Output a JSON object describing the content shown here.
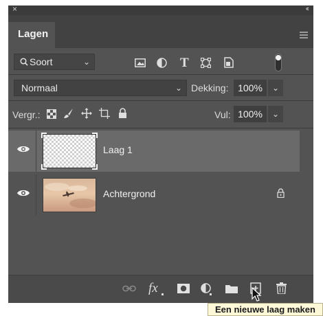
{
  "panel": {
    "tab_title": "Lagen",
    "close_glyph": "×",
    "collapse_glyph": "‹‹"
  },
  "filter": {
    "search_label": "Soort",
    "icons": [
      "image-filter-icon",
      "adjustment-filter-icon",
      "type-filter-icon",
      "shape-filter-icon",
      "smart-object-filter-icon",
      "filter-toggle-icon"
    ]
  },
  "blend": {
    "mode": "Normaal",
    "opacity_label": "Dekking:",
    "opacity_value": "100%"
  },
  "lock": {
    "label": "Vergr.:",
    "fill_label": "Vul:",
    "fill_value": "100%"
  },
  "layers": [
    {
      "name": "Laag 1",
      "visible": true,
      "selected": true,
      "thumbnail": "transparent"
    },
    {
      "name": "Achtergrond",
      "visible": true,
      "selected": false,
      "thumbnail": "sky-with-airplane",
      "locked": true
    }
  ],
  "bottom_icons": [
    "link-layers-icon",
    "fx-icon",
    "layer-mask-icon",
    "adjustment-layer-icon",
    "group-folder-icon",
    "new-layer-icon",
    "trash-icon"
  ],
  "fx_label": "fx",
  "tooltip": "Een nieuwe laag maken"
}
